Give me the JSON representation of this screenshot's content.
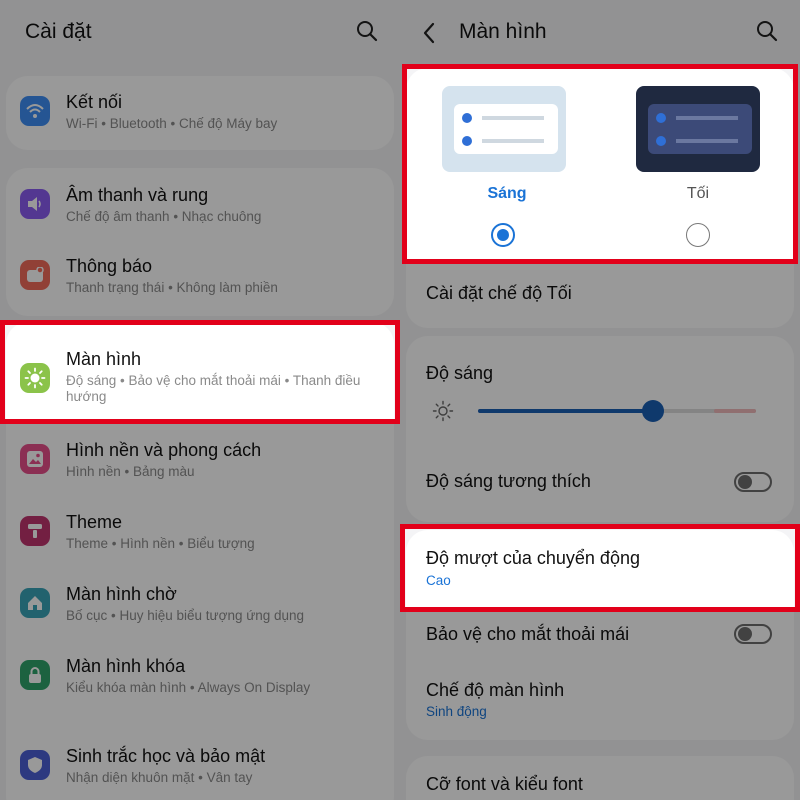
{
  "left": {
    "title": "Cài đặt",
    "items": [
      {
        "title": "Kết nối",
        "subtitle": "Wi-Fi  •  Bluetooth  •  Chế độ Máy bay",
        "icon": "wifi-icon",
        "color": "#3e8ef5"
      },
      {
        "title": "Âm thanh và rung",
        "subtitle": "Chế độ âm thanh  •  Nhạc chuông",
        "icon": "speaker-icon",
        "color": "#8a5cf2"
      },
      {
        "title": "Thông báo",
        "subtitle": "Thanh trạng thái  •  Không làm phiền",
        "icon": "notification-icon",
        "color": "#f26b5b"
      },
      {
        "title": "Màn hình",
        "subtitle": "Độ sáng  •  Bảo vệ cho mắt thoải mái  •  Thanh điều hướng",
        "icon": "sun-icon",
        "color": "#8bc34a"
      },
      {
        "title": "Hình nền và phong cách",
        "subtitle": "Hình nền  •  Bảng màu",
        "icon": "wallpaper-icon",
        "color": "#e84f8a"
      },
      {
        "title": "Theme",
        "subtitle": "Theme  •  Hình nền  •  Biểu tượng",
        "icon": "theme-icon",
        "color": "#c0356f"
      },
      {
        "title": "Màn hình chờ",
        "subtitle": "Bố cục  •  Huy hiệu biểu tượng ứng dụng",
        "icon": "home-icon",
        "color": "#3aa3b8"
      },
      {
        "title": "Màn hình khóa",
        "subtitle": "Kiểu khóa màn hình  •  Always On Display",
        "icon": "lock-icon",
        "color": "#2fa36b"
      },
      {
        "title": "Sinh trắc học và bảo mật",
        "subtitle": "Nhận diện khuôn mặt  •  Vân tay",
        "icon": "shield-icon",
        "color": "#4b5fd6"
      }
    ]
  },
  "right": {
    "title": "Màn hình",
    "theme_light_label": "Sáng",
    "theme_dark_label": "Tối",
    "dark_settings_label": "Cài đặt chế độ Tối",
    "brightness_label": "Độ sáng",
    "brightness_level": 0.63,
    "adaptive_brightness_label": "Độ sáng tương thích",
    "motion_label": "Độ mượt của chuyển động",
    "motion_value": "Cao",
    "eye_comfort_label": "Bảo vệ cho mắt thoải mái",
    "screen_mode_label": "Chế độ màn hình",
    "screen_mode_value": "Sinh động",
    "font_label": "Cỡ font và kiểu font"
  },
  "colors": {
    "highlight_border": "#e2001a",
    "accent": "#1a73d6"
  }
}
